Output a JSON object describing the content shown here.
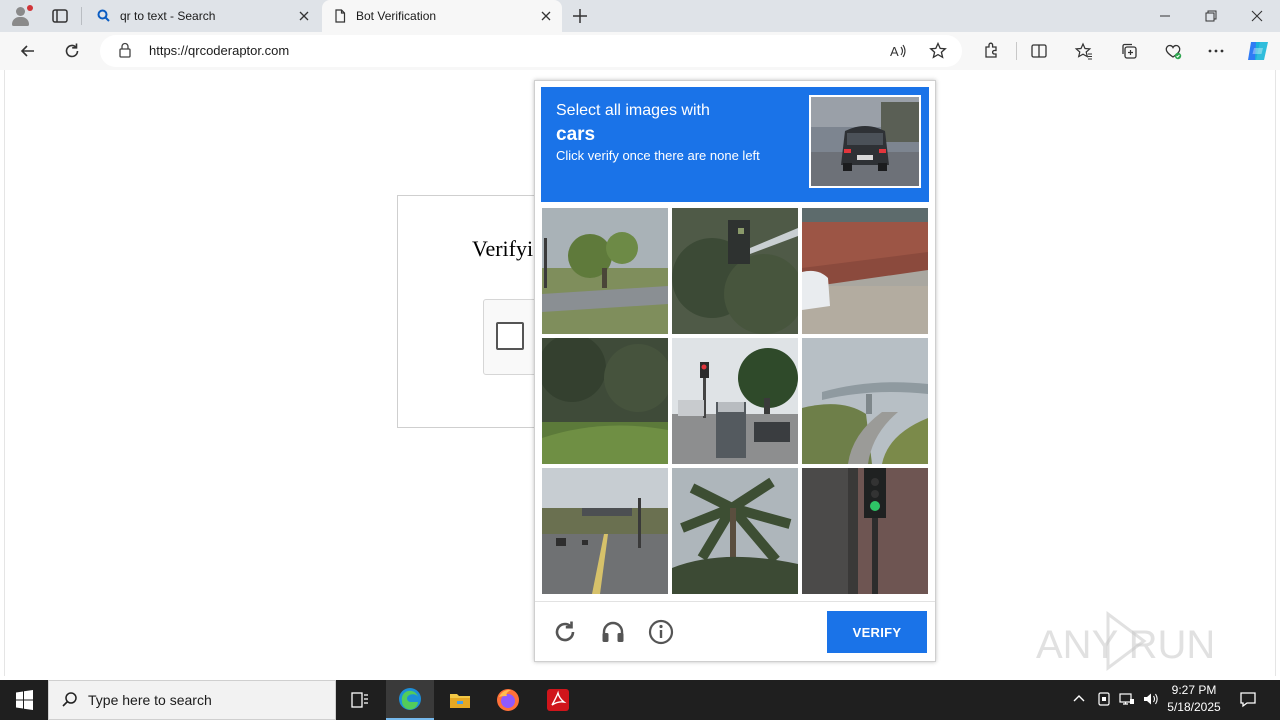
{
  "browser": {
    "tabs": [
      {
        "title": "qr to text - Search",
        "active": false
      },
      {
        "title": "Bot Verification",
        "active": true
      }
    ],
    "address": {
      "url": "https://qrcoderaptor.com"
    }
  },
  "page": {
    "verify_title": "Verifyi"
  },
  "captcha": {
    "instruction_line1": "Select all images with",
    "target": "cars",
    "instruction_line3": "Click verify once there are none left",
    "verify_label": "VERIFY",
    "colors": {
      "accent": "#1a73e8"
    }
  },
  "watermark": {
    "text": "ANY RUN"
  },
  "taskbar": {
    "search_placeholder": "Type here to search",
    "time": "9:27 PM",
    "date": "5/18/2025"
  }
}
